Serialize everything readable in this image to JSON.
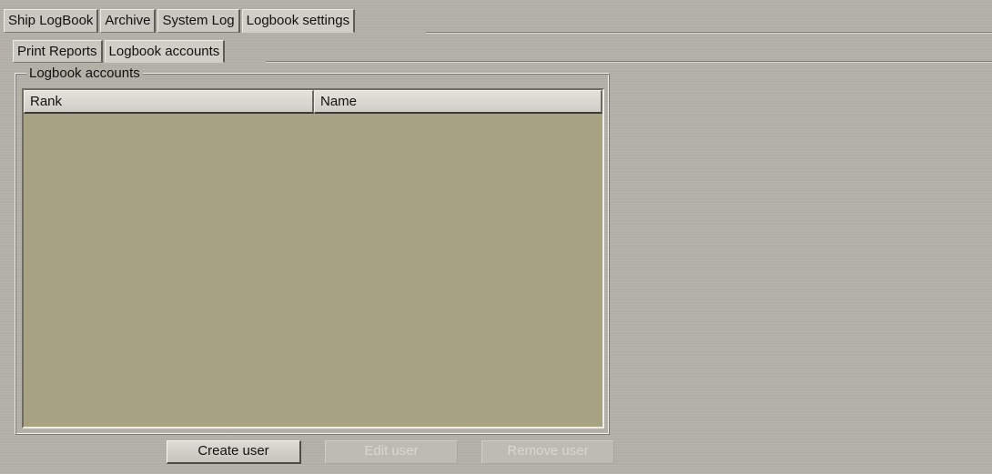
{
  "tabs": [
    {
      "label": "Ship LogBook",
      "active": false
    },
    {
      "label": "Archive",
      "active": false
    },
    {
      "label": "System Log",
      "active": false
    },
    {
      "label": "Logbook settings",
      "active": true
    }
  ],
  "subtabs": [
    {
      "label": "Print Reports",
      "active": false
    },
    {
      "label": "Logbook accounts",
      "active": true
    }
  ],
  "group": {
    "title": "Logbook accounts"
  },
  "table": {
    "columns": [
      "Rank",
      "Name"
    ],
    "rows": []
  },
  "buttons": {
    "create_label": "Create user",
    "edit_label": "Edit user",
    "remove_label": "Remove user",
    "edit_enabled": false,
    "remove_enabled": false
  },
  "colors": {
    "background": "#b2b0a7",
    "table_body": "#a7a382",
    "disabled_text": "#d9d7d0"
  }
}
